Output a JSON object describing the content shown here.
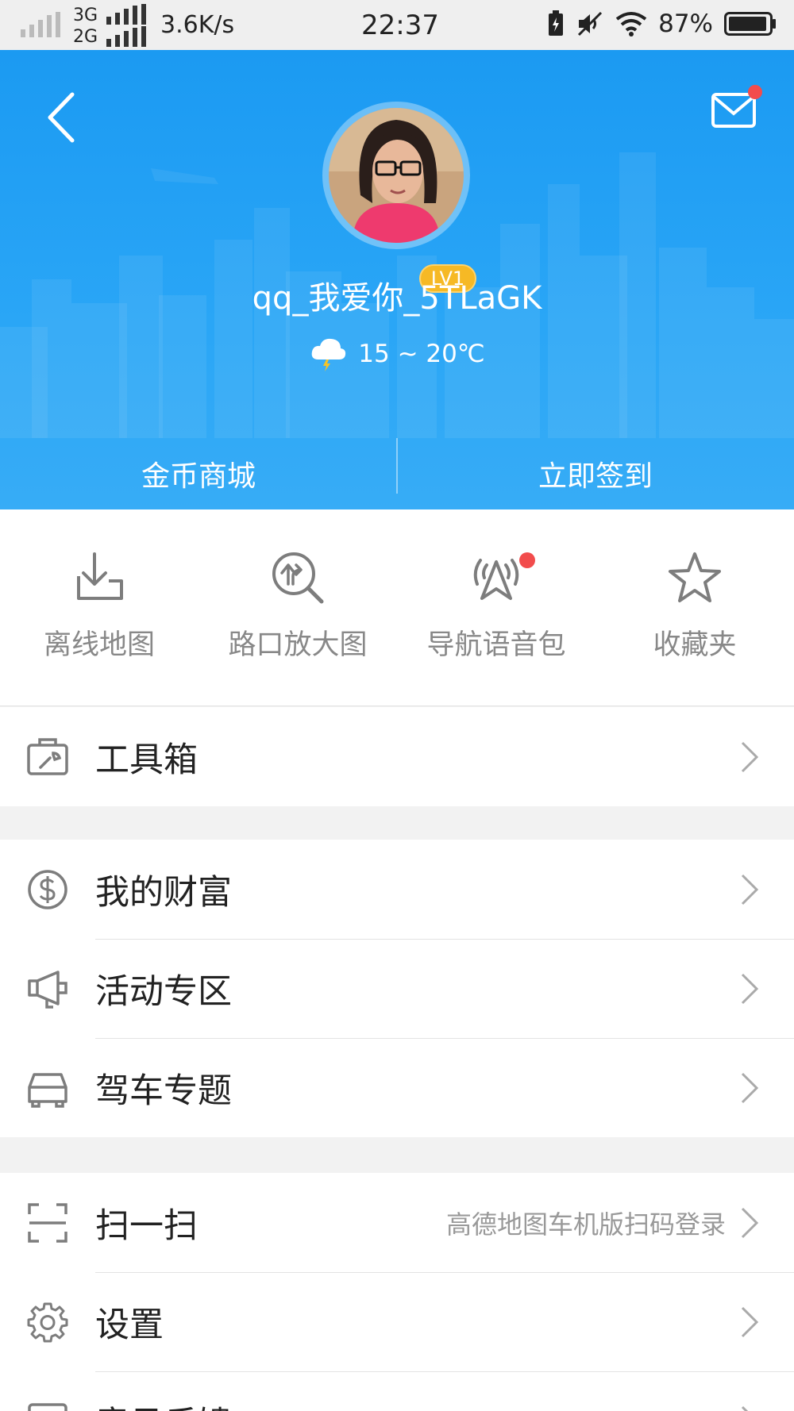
{
  "status_bar": {
    "network_1": "3G",
    "network_2": "2G",
    "speed": "3.6K/s",
    "time": "22:37",
    "battery_percent": "87%",
    "icons": [
      "signal-icon",
      "charging-icon",
      "mute-icon",
      "wifi-icon",
      "battery-icon"
    ]
  },
  "header": {
    "username": "qq_我爱你_5TLaGK",
    "level_badge": "LV1",
    "weather_text": "15 ~ 20℃",
    "weather_icon": "cloud-thunder-icon",
    "actions": [
      {
        "label": "金币商城"
      },
      {
        "label": "立即签到"
      }
    ],
    "has_unread_mail": true,
    "colors": {
      "top": "#1b9af2",
      "bottom": "#37acf6"
    }
  },
  "quick_actions": [
    {
      "label": "离线地图",
      "icon": "download-box-icon"
    },
    {
      "label": "路口放大图",
      "icon": "junction-zoom-icon"
    },
    {
      "label": "导航语音包",
      "icon": "voice-broadcast-icon",
      "badge": true
    },
    {
      "label": "收藏夹",
      "icon": "star-icon"
    }
  ],
  "group1": [
    {
      "title": "工具箱",
      "icon": "toolbox-icon"
    }
  ],
  "group2": [
    {
      "title": "我的财富",
      "icon": "dollar-coin-icon"
    },
    {
      "title": "活动专区",
      "icon": "megaphone-icon"
    },
    {
      "title": "驾车专题",
      "icon": "car-icon"
    }
  ],
  "group3": [
    {
      "title": "扫一扫",
      "subtitle": "高德地图车机版扫码登录",
      "icon": "scan-icon"
    },
    {
      "title": "设置",
      "icon": "gear-icon"
    },
    {
      "title": "意见反馈",
      "icon": "feedback-icon"
    }
  ]
}
